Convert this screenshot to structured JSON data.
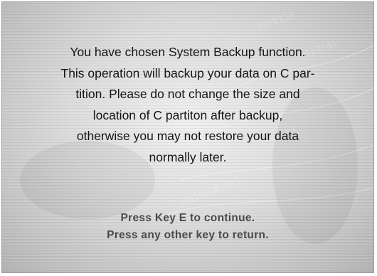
{
  "message": {
    "lines": [
      "You have chosen System Backup function.",
      "This operation will backup your data on C par-",
      "tition. Please do not change the size and",
      "location of C partiton after backup,",
      "otherwise you may not restore your data",
      "normally later."
    ]
  },
  "prompt": {
    "continue_text": "Press Key E to continue.",
    "return_text": "Press any other key to return."
  },
  "colors": {
    "message_text": "#151515",
    "prompt_text": "#4a4a4a"
  }
}
